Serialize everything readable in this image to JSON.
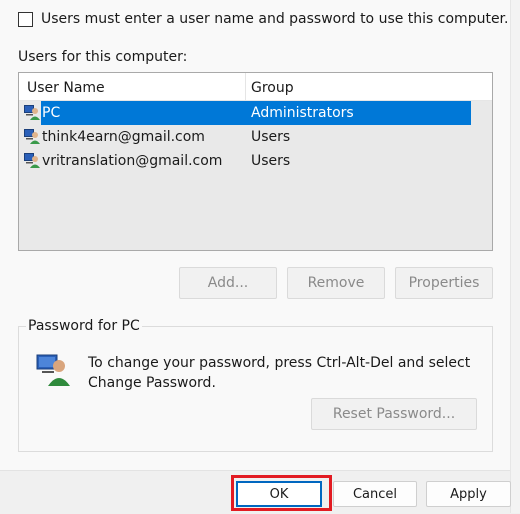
{
  "checkbox_label": "Users must enter a user name and password to use this computer.",
  "users_label": "Users for this computer:",
  "list": {
    "headers": [
      "User Name",
      "Group"
    ],
    "rows": [
      {
        "name": "PC",
        "group": "Administrators",
        "selected": true
      },
      {
        "name": "think4earn@gmail.com",
        "group": "Users",
        "selected": false
      },
      {
        "name": "vritranslation@gmail.com",
        "group": "Users",
        "selected": false
      }
    ]
  },
  "buttons": {
    "add": "Add...",
    "remove": "Remove",
    "properties": "Properties"
  },
  "password_group": {
    "title": "Password for PC",
    "line1": "To change your password, press Ctrl-Alt-Del and select",
    "line2": "Change Password.",
    "reset": "Reset Password..."
  },
  "footer": {
    "ok": "OK",
    "cancel": "Cancel",
    "apply": "Apply"
  },
  "colors": {
    "selection": "#0078d7",
    "highlight": "#e21b22",
    "ok_border": "#0067c0"
  }
}
